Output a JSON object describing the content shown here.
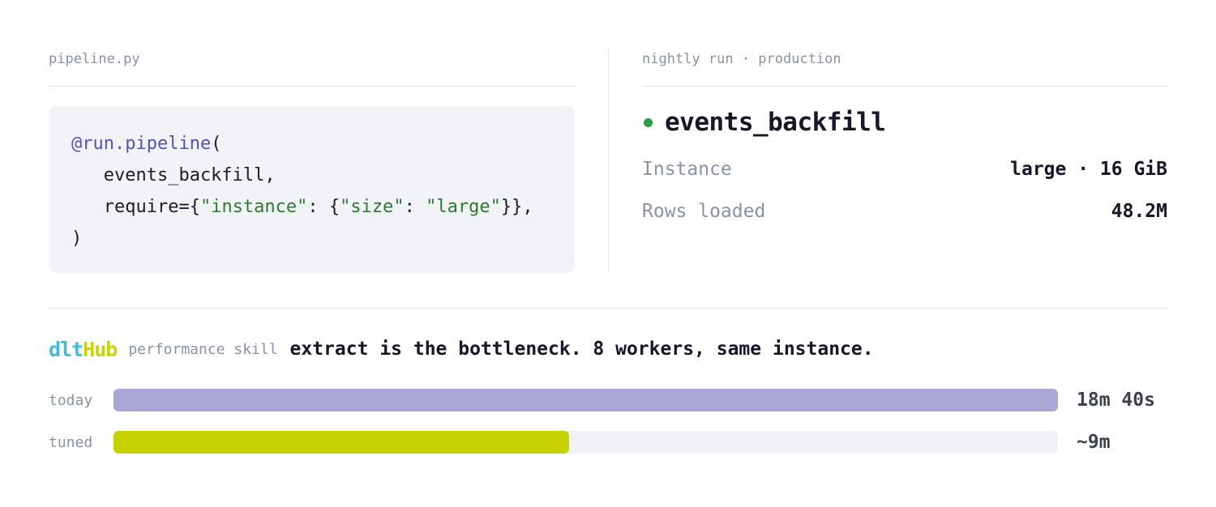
{
  "left_panel": {
    "file_label": "pipeline.py",
    "code_lines": [
      [
        {
          "text": "@run.pipeline",
          "kind": "deco"
        },
        {
          "text": "(",
          "kind": "plain"
        }
      ],
      [
        {
          "text": "   events_backfill,",
          "kind": "plain"
        }
      ],
      [
        {
          "text": "   require={",
          "kind": "plain"
        },
        {
          "text": "\"instance\"",
          "kind": "str"
        },
        {
          "text": ": {",
          "kind": "plain"
        },
        {
          "text": "\"size\"",
          "kind": "str"
        },
        {
          "text": ": ",
          "kind": "plain"
        },
        {
          "text": "\"large\"",
          "kind": "str"
        },
        {
          "text": "}},",
          "kind": "plain"
        }
      ],
      [
        {
          "text": ")",
          "kind": "plain"
        }
      ]
    ]
  },
  "right_panel": {
    "context_label": "nightly run · production",
    "run_name": "events_backfill",
    "status_color": "#2e9a4a",
    "metrics": [
      {
        "key": "Instance",
        "value": "large · 16 GiB"
      },
      {
        "key": "Rows loaded",
        "value": "48.2M"
      }
    ]
  },
  "insight": {
    "brand_part1": "dlt",
    "brand_part2": "Hub",
    "skill_tag": "performance skill",
    "message": "extract is the bottleneck. 8 workers, same instance."
  },
  "comparison": [
    {
      "label": "today",
      "value_text": "18m 40s",
      "fraction": 1.0,
      "color": "#aaa7d6"
    },
    {
      "label": "tuned",
      "value_text": "~9m",
      "fraction": 0.482,
      "color": "#c6d300"
    }
  ]
}
